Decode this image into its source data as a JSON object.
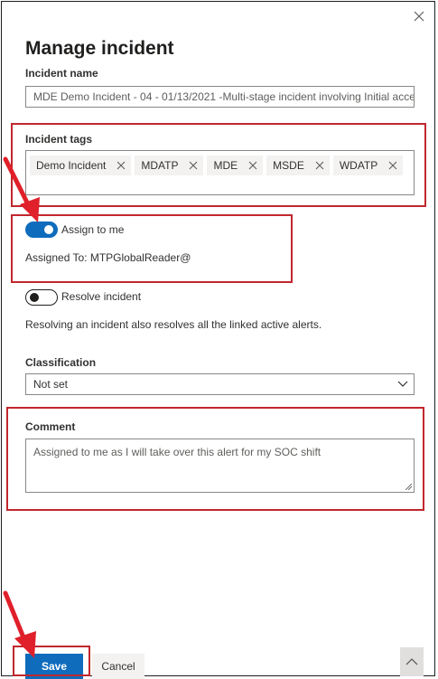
{
  "panel": {
    "title": "Manage incident",
    "close_icon": "close-icon"
  },
  "incident_name": {
    "label": "Incident name",
    "value": "MDE Demo Incident - 04 - 01/13/2021 -Multi-stage incident involving Initial acces"
  },
  "incident_tags": {
    "label": "Incident tags",
    "tags": [
      "Demo Incident",
      "MDATP",
      "MDE",
      "MSDE",
      "WDATP"
    ]
  },
  "assign": {
    "toggle_label": "Assign to me",
    "toggle_on": true,
    "assigned_to": "Assigned To: MTPGlobalReader@"
  },
  "resolve": {
    "toggle_label": "Resolve incident",
    "toggle_on": false,
    "note": "Resolving an incident also resolves all the linked active alerts."
  },
  "classification": {
    "label": "Classification",
    "selected": "Not set"
  },
  "comment": {
    "label": "Comment",
    "value": "Assigned to me as I will take over this alert for my SOC shift"
  },
  "footer": {
    "save_label": "Save",
    "cancel_label": "Cancel"
  },
  "colors": {
    "accent": "#0f6cbd",
    "annotation": "#c1272d"
  }
}
